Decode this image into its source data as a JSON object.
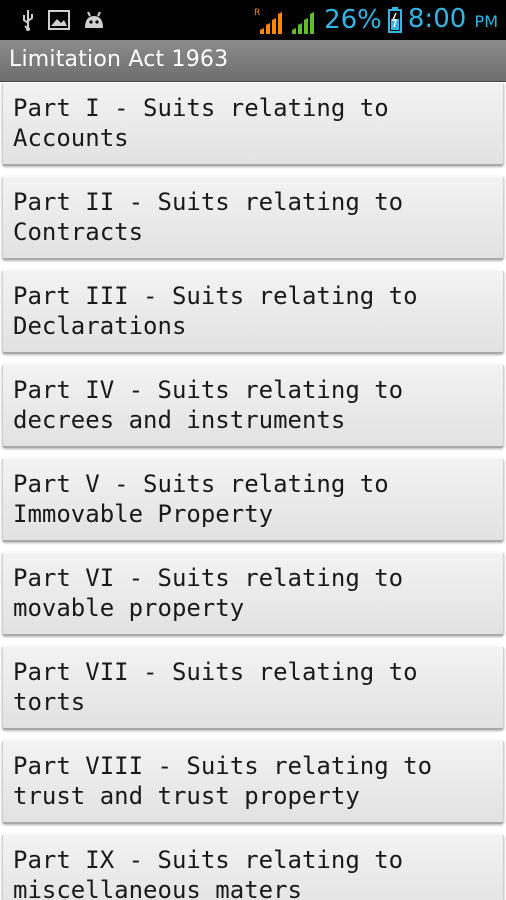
{
  "status_bar": {
    "battery_percent": "26%",
    "time": "8:00",
    "ampm": "PM",
    "icons": [
      "usb-icon",
      "image-icon",
      "android-icon",
      "roaming-signal-icon",
      "signal-icon",
      "battery-icon"
    ]
  },
  "app": {
    "title": "Limitation Act 1963"
  },
  "items": [
    {
      "label": "Part I - Suits relating to\nAccounts"
    },
    {
      "label": "Part II - Suits relating to\nContracts"
    },
    {
      "label": "Part III - Suits relating to\nDeclarations"
    },
    {
      "label": "Part IV - Suits relating to\ndecrees and instruments"
    },
    {
      "label": "Part V - Suits relating to\nImmovable Property"
    },
    {
      "label": "Part VI - Suits relating to\nmovable property"
    },
    {
      "label": "Part VII - Suits relating to\ntorts"
    },
    {
      "label": "Part VIII - Suits relating to\ntrust and trust property"
    },
    {
      "label": "Part IX - Suits relating to\nmiscellaneous maters"
    }
  ]
}
